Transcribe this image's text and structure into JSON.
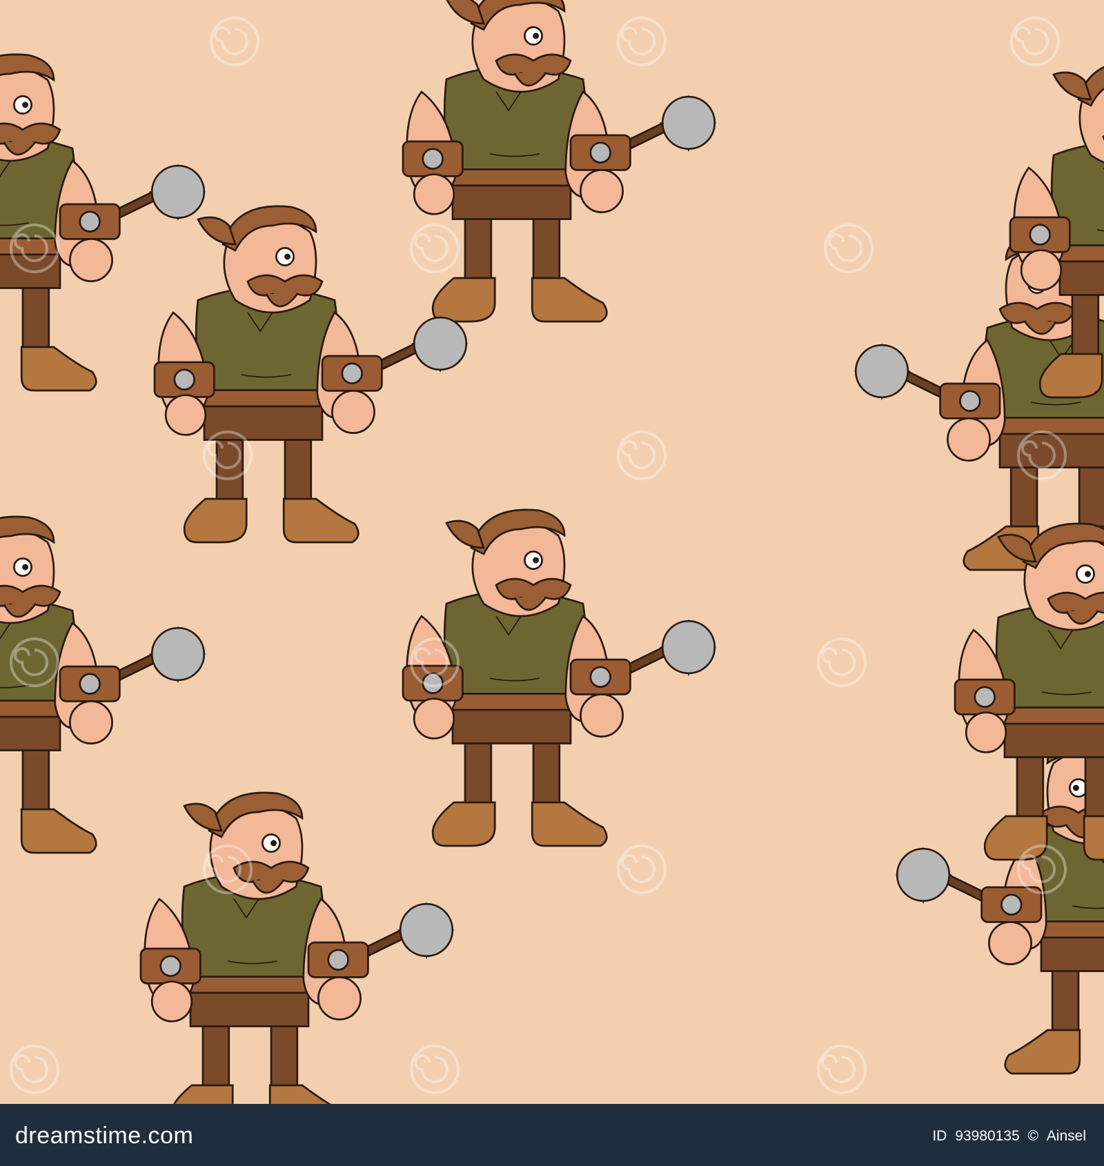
{
  "pattern": {
    "description_colors": {
      "background": "#f3cfb0",
      "skin": "#f2b898",
      "tunic": "#6e6632",
      "leather": "#9a5c33",
      "pants": "#7a4a2a",
      "boots": "#b4773f",
      "hair": "#9a5f34",
      "metal": "#b8b8b8",
      "stick": "#6b3f22",
      "outline": "#2a1a10"
    },
    "motif": "barbarian-with-mace",
    "watermark_text": "dreamstime"
  },
  "footer": {
    "brand": "dreamstime.com",
    "id_label": "ID",
    "id_value": "93980135",
    "copyright": "©",
    "author": "Ainsel",
    "background": "#1f2e3c"
  }
}
